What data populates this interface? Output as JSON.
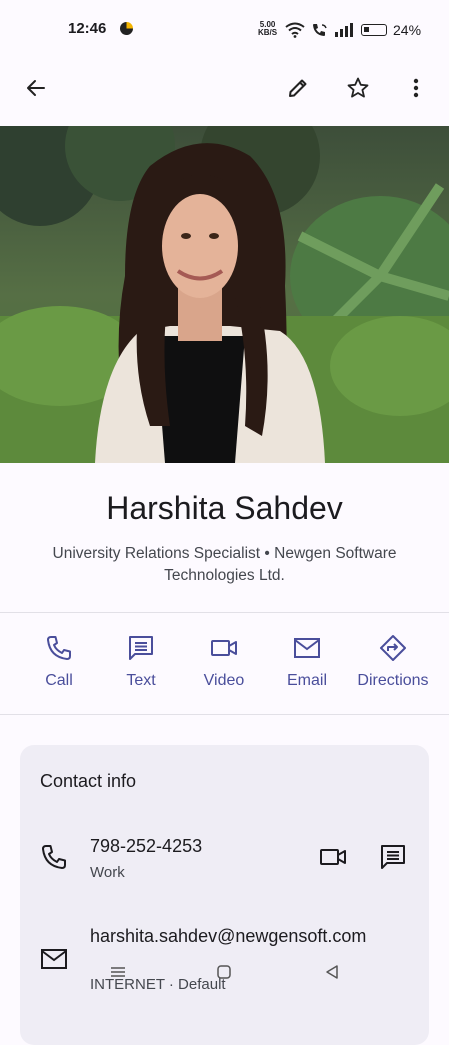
{
  "status": {
    "time": "12:46",
    "net_speed_value": "5.00",
    "net_speed_unit": "KB/S",
    "battery": "24%"
  },
  "icons": {
    "back": "arrow-left",
    "edit": "pencil",
    "favorite": "star-outline",
    "more": "three-dots-vertical"
  },
  "contact": {
    "name": "Harshita Sahdev",
    "subtitle": "University Relations Specialist • Newgen Software Technologies Ltd."
  },
  "actions": [
    {
      "label": "Call",
      "icon": "phone"
    },
    {
      "label": "Text",
      "icon": "message"
    },
    {
      "label": "Video",
      "icon": "video"
    },
    {
      "label": "Email",
      "icon": "mail"
    },
    {
      "label": "Directions",
      "icon": "directions"
    }
  ],
  "contact_info": {
    "title": "Contact info",
    "phone": {
      "value": "798-252-4253",
      "type": "Work"
    },
    "email": {
      "value": "harshita.sahdev@newgensoft.com",
      "type": "INTERNET · Default"
    }
  },
  "colors": {
    "accent": "#4a4e9b",
    "background": "#fdfaff",
    "card": "#efedf5"
  }
}
